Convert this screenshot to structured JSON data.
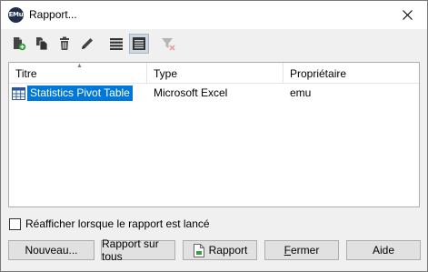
{
  "window": {
    "title": "Rapport...",
    "app_icon_text": "EMu"
  },
  "toolbar": {
    "buttons": [
      {
        "name": "new-report",
        "icon": "new-document-icon"
      },
      {
        "name": "copy-report",
        "icon": "copy-icon"
      },
      {
        "name": "delete-report",
        "icon": "trash-icon"
      },
      {
        "name": "edit-report",
        "icon": "pencil-icon"
      },
      {
        "name": "list-view",
        "icon": "list-view-icon"
      },
      {
        "name": "details-view",
        "icon": "details-view-icon",
        "active": true
      },
      {
        "name": "clear-filter",
        "icon": "filter-clear-icon",
        "disabled": true
      }
    ]
  },
  "table": {
    "columns": [
      "Titre",
      "Type",
      "Propriétaire"
    ],
    "sort_column": "Titre",
    "rows": [
      {
        "title": "Statistics Pivot Table",
        "type": "Microsoft Excel",
        "owner": "emu",
        "selected": true
      }
    ]
  },
  "checkbox": {
    "label": "Réafficher lorsque le rapport est lancé",
    "checked": false
  },
  "buttons": {
    "new": "Nouveau...",
    "report_all": "Rapport sur tous",
    "report": "Rapport",
    "close_underlined": "F",
    "close_rest": "ermer",
    "help": "Aide"
  },
  "colors": {
    "selection": "#0078d7",
    "dialog_bg": "#f0f0f0",
    "button_bg": "#e1e1e1"
  }
}
